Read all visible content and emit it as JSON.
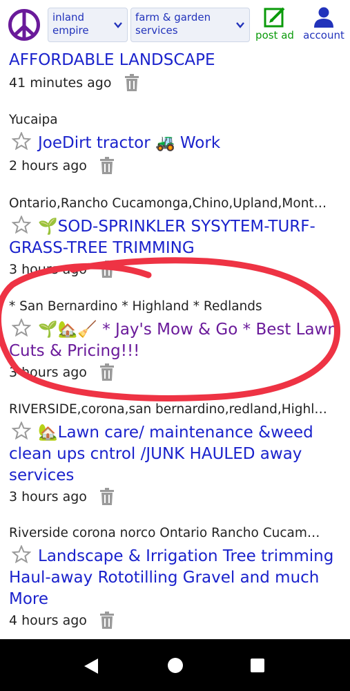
{
  "header": {
    "region_select": {
      "value": "inland empire"
    },
    "category_select": {
      "value": "farm & garden services"
    },
    "post_ad_label": "post ad",
    "account_label": "account"
  },
  "listings": [
    {
      "location": "",
      "title": "AFFORDABLE LANDSCAPE",
      "time": "41 minutes ago",
      "visited": false
    },
    {
      "location": "Yucaipa",
      "title": "JoeDirt tractor 🚜 Work",
      "time": "2 hours ago",
      "visited": false
    },
    {
      "location": "Ontario,Rancho Cucamonga,Chino,Upland,Mont…",
      "title": "🌱SOD-SPRINKLER SYSYTEM-TURF-GRASS-TREE TRIMMING",
      "time": "3 hours ago",
      "visited": false
    },
    {
      "location": "* San Bernardino * Highland * Redlands",
      "title": "🌱🏡🧹 * Jay's Mow & Go * Best Lawn Cuts & Pricing!!!",
      "time": "3 hours ago",
      "visited": true
    },
    {
      "location": "RIVERSIDE,corona,san bernardino,redland,Highl…",
      "title": "🏡Lawn care/ maintenance &weed clean ups cntrol /JUNK HAULED away services",
      "time": "3 hours ago",
      "visited": false
    },
    {
      "location": "Riverside corona norco Ontario Rancho Cucam…",
      "title": "Landscape & Irrigation Tree trimming Haul-away Rototilling Gravel and much More",
      "time": "4 hours ago",
      "visited": false
    }
  ],
  "colors": {
    "link": "#1a22cc",
    "visited": "#6a1a9a",
    "post_green": "#0a9a0a",
    "annotation_red": "#ee3344"
  }
}
